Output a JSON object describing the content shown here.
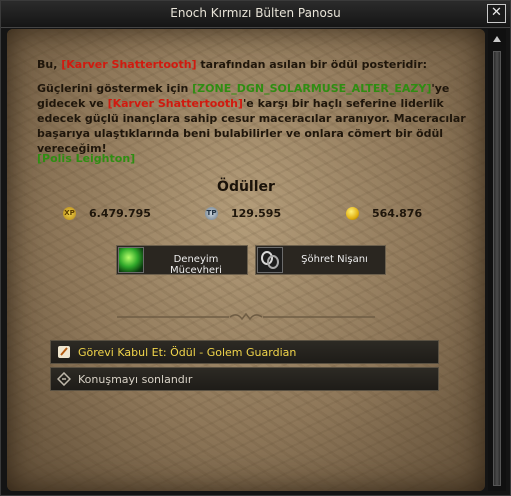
{
  "window": {
    "title": "Enoch Kırmızı Bülten Panosu",
    "close_label": "✕"
  },
  "quest": {
    "p1_prefix": "Bu, ",
    "p1_name": "[Karver Shattertooth]",
    "p1_suffix": " tarafından asılan bir ödül posteridir:",
    "p2_a": "Güçlerini göstermek için ",
    "p2_zone": "[ZONE_DGN_SOLARMUSE_ALTER_EAZY]",
    "p2_b": "'ye gidecek ve ",
    "p2_name": "[Karver Shattertooth]",
    "p2_c": "'e karşı bir haçlı seferine liderlik edecek güçlü inançlara sahip cesur maceracılar aranıyor. Maceracılar başarıya ulaştıklarında beni bulabilirler ve onlara cömert bir ödül vereceğim!",
    "signature": "[Polis Leighton]"
  },
  "rewards": {
    "title": "Ödüller",
    "xp_icon": "XP",
    "xp_value": "6.479.795",
    "tp_icon": "TP",
    "tp_value": "129.595",
    "gold_value": "564.876",
    "items": [
      {
        "label": "Deneyim Mücevheri",
        "icon": "green-gem-icon"
      },
      {
        "label": "Şöhret Nişanı",
        "icon": "chain-ring-icon"
      }
    ]
  },
  "actions": [
    {
      "label": "Görevi Kabul Et: Ödül - Golem Guardian",
      "icon": "quest-scroll-icon",
      "color": "#f0d44a"
    },
    {
      "label": "Konuşmayı sonlandır",
      "icon": "end-dialog-icon",
      "color": "#d8d2c6"
    }
  ],
  "colors": {
    "npc_red": "#d11a0f",
    "signature_green": "#2f8d12",
    "accept_yellow": "#f0d44a"
  }
}
